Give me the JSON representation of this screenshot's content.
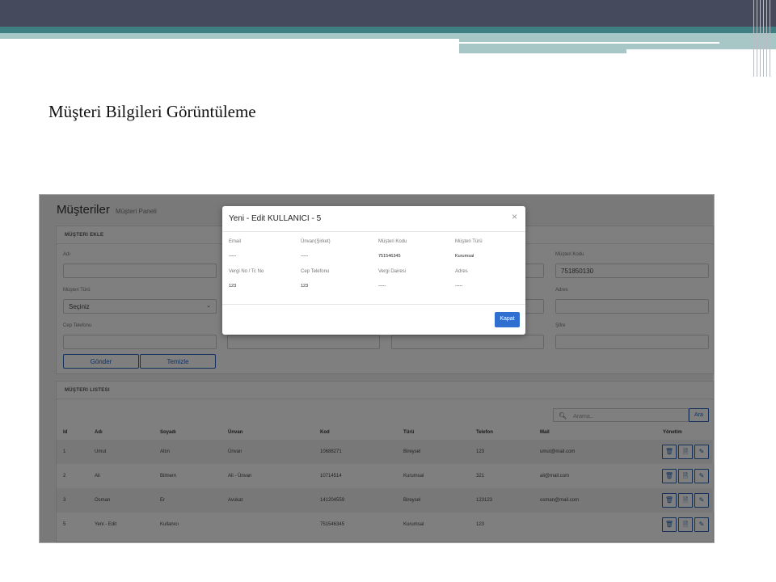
{
  "slide": {
    "title": "Müşteri Bilgileri Görüntüleme"
  },
  "app": {
    "heading": "Müşteriler",
    "subheading": "Müşteri Paneli",
    "add_card": {
      "title": "MÜŞTERI EKLE",
      "labels": {
        "adi": "Adı",
        "musteri_kodu": "Müşteri Kodu",
        "musteri_turu": "Müşteri Türü",
        "adres": "Adres",
        "cep": "Cep Telefonu",
        "sifre": "Şifre"
      },
      "values": {
        "musteri_kodu": "751850130",
        "musteri_turu": "Seçiniz"
      },
      "buttons": {
        "gonder": "Gönder",
        "temizle": "Temizle"
      }
    },
    "list_card": {
      "title": "MÜŞTERI LISTESI",
      "search_placeholder": "Arama..",
      "search_button": "Ara",
      "columns": [
        "Id",
        "Adı",
        "Soyadı",
        "Ünvan",
        "Kod",
        "Türü",
        "Telefon",
        "Mail",
        "Yönetim"
      ],
      "rows": [
        {
          "id": "1",
          "adi": "Umut",
          "soyadi": "Altın",
          "unvan": "Ünvan",
          "kod": "10688271",
          "turu": "Bireysel",
          "telefon": "123",
          "mail": "umut@mail.com"
        },
        {
          "id": "2",
          "adi": "Ali",
          "soyadi": "Bilmem",
          "unvan": "Ali - Ünvan",
          "kod": "10714514",
          "turu": "Kurumsal",
          "telefon": "321",
          "mail": "ali@mail.com"
        },
        {
          "id": "3",
          "adi": "Osman",
          "soyadi": "Er",
          "unvan": "Avukat",
          "kod": "141204559",
          "turu": "Bireysel",
          "telefon": "123123",
          "mail": "osman@mail.com"
        },
        {
          "id": "5",
          "adi": "Yeni - Edit",
          "soyadi": "Kullanıcı",
          "unvan": "",
          "kod": "751546345",
          "turu": "Kurumsal",
          "telefon": "123",
          "mail": ""
        }
      ]
    }
  },
  "modal": {
    "title": "Yeni - Edit KULLANICI - 5",
    "close": "×",
    "fields": {
      "email_label": "Email",
      "email_value": "-----",
      "unvan_label": "Ünvan(Şirket)",
      "unvan_value": "-----",
      "kod_label": "Müşteri Kodu",
      "kod_value": "751546345",
      "turu_label": "Müşteri Türü",
      "turu_value": "Kurumsal",
      "vergi_label": "Vergi No / Tc No",
      "vergi_value": "123",
      "cep_label": "Cep Telefonu",
      "cep_value": "123",
      "daire_label": "Vergi Dairesi",
      "daire_value": "-----",
      "adres_label": "Adres",
      "adres_value": "-----"
    },
    "button": "Kapat"
  },
  "colors": {
    "primary": "#2f6fd0",
    "topbar": "#454a5c",
    "teal": "#3f7f83",
    "light_teal": "#a7c6c6"
  }
}
